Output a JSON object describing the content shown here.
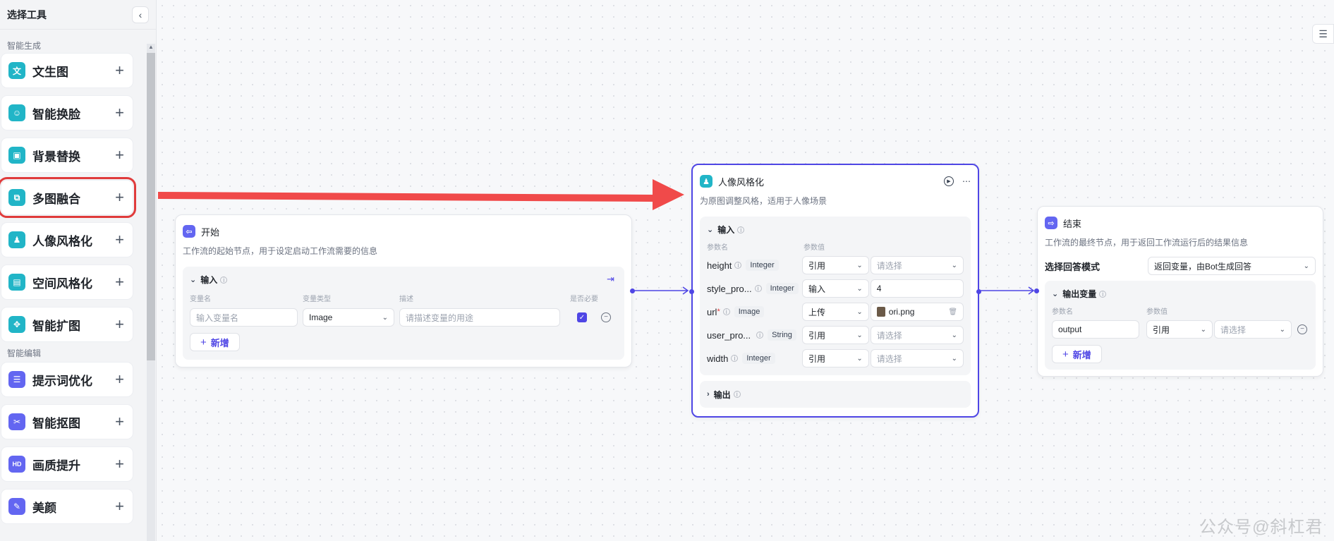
{
  "sidebar": {
    "title": "选择工具",
    "collapse_icon": "‹",
    "group1": "智能生成",
    "group2": "智能编辑",
    "items": [
      {
        "label": "文生图",
        "icon": "文"
      },
      {
        "label": "智能换脸",
        "icon": "☺"
      },
      {
        "label": "背景替换",
        "icon": "▣"
      },
      {
        "label": "多图融合",
        "icon": "⧉"
      },
      {
        "label": "人像风格化",
        "icon": "♟"
      },
      {
        "label": "空间风格化",
        "icon": "▤"
      },
      {
        "label": "智能扩图",
        "icon": "✥"
      },
      {
        "label": "提示词优化",
        "icon": "☰"
      },
      {
        "label": "智能抠图",
        "icon": "✂"
      },
      {
        "label": "画质提升",
        "icon": "HD"
      },
      {
        "label": "美颜",
        "icon": "✎"
      }
    ],
    "plus": "+"
  },
  "start_node": {
    "title": "开始",
    "desc": "工作流的起始节点，用于设定启动工作流需要的信息",
    "section": "输入",
    "cols": [
      "变量名",
      "变量类型",
      "描述",
      "是否必要"
    ],
    "var_placeholder": "输入变量名",
    "type_value": "Image",
    "desc_placeholder": "请描述变量的用途",
    "add": "新增"
  },
  "style_node": {
    "title": "人像风格化",
    "desc": "为原图调整风格，适用于人像场景",
    "section": "输入",
    "cols": [
      "参数名",
      "参数值"
    ],
    "params": [
      {
        "name": "height",
        "type": "Integer",
        "mode": "引用",
        "value": "请选择",
        "placeholder": true
      },
      {
        "name": "style_pro...",
        "type": "Integer",
        "mode": "输入",
        "value": "4",
        "placeholder": false
      },
      {
        "name": "url",
        "type": "Image",
        "mode": "上传",
        "value": "ori.png",
        "placeholder": false
      },
      {
        "name": "user_pro...",
        "type": "String",
        "mode": "引用",
        "value": "请选择",
        "placeholder": true
      },
      {
        "name": "width",
        "type": "Integer",
        "mode": "引用",
        "value": "请选择",
        "placeholder": true
      }
    ],
    "output": "输出"
  },
  "end_node": {
    "title": "结束",
    "desc": "工作流的最终节点，用于返回工作流运行后的结果信息",
    "mode_label": "选择回答模式",
    "mode_value": "返回变量，由Bot生成回答",
    "section": "输出变量",
    "cols": [
      "参数名",
      "参数值"
    ],
    "var_value": "output",
    "ref_mode": "引用",
    "ref_placeholder": "请选择",
    "add": "新增"
  },
  "watermark": "公众号@斜杠君",
  "colors": {
    "accent": "#4f46e5",
    "teal": "#21b5c7",
    "arrow": "#f04a4a",
    "highlight": "#e03b3b"
  }
}
